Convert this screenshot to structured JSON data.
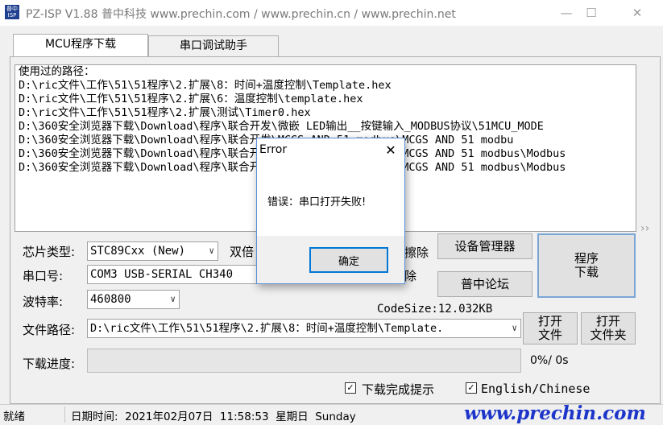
{
  "window": {
    "title": "PZ-ISP V1.88 普中科技 www.prechin.com / www.prechin.cn / www.prechin.net",
    "icon_label": "普中ISP"
  },
  "tabs": [
    {
      "label": "MCU程序下载",
      "active": true
    },
    {
      "label": "串口调试助手",
      "active": false
    }
  ],
  "path_list": {
    "lines": [
      "使用过的路径：",
      "D:\\ric文件\\工作\\51\\51程序\\2.扩展\\8：时间+温度控制\\Template.hex",
      "D:\\ric文件\\工作\\51\\51程序\\2.扩展\\6：温度控制\\template.hex",
      "D:\\ric文件\\工作\\51\\51程序\\2.扩展\\测试\\Timer0.hex",
      "D:\\360安全浏览器下载\\Download\\程序\\联合开发\\微嵌 LED输出__按键输入_MODBUS协议\\51MCU_MODE",
      "D:\\360安全浏览器下载\\Download\\程序\\联合开发\\MCGS-AND-51-modbus\\MCGS AND 51 modbu",
      "D:\\360安全浏览器下载\\Download\\程序\\联合开发\\MCGS-AND-51-modbus\\MCGS AND 51 modbus\\Modbus",
      "D:\\360安全浏览器下载\\Download\\程序\\联合开发\\MCGS-AND-51-modbus\\MCGS AND 51 modbus\\Modbus"
    ]
  },
  "form": {
    "chip_label": "芯片类型:",
    "chip_value": "STC89Cxx (New)",
    "double_speed_label": "双倍",
    "erase_label": "擦除",
    "erase_label2": "除",
    "port_label": "串口号:",
    "port_value": "COM3  USB-SERIAL CH340",
    "baud_label": "波特率:",
    "baud_value": "460800",
    "code_size": "CodeSize:12.032KB",
    "file_path_label": "文件路径:",
    "file_path_value": "D:\\ric文件\\工作\\51\\51程序\\2.扩展\\8：时间+温度控制\\Template.",
    "progress_label": "下载进度:",
    "progress_text": "0%/ 0s",
    "progress_value": 0
  },
  "buttons": {
    "device_manager": "设备管理器",
    "forum": "普中论坛",
    "download": "程序\n下载",
    "open_file": "打开\n文件",
    "open_folder": "打开\n文件夹"
  },
  "checkboxes": {
    "download_done_tip": {
      "label": "下载完成提示",
      "checked": true
    },
    "language": {
      "label": "English/Chinese",
      "checked": true
    }
  },
  "status_bar": {
    "state": "就绪",
    "datetime": "日期时间:  2021年02月07日  11:58:53  星期日  Sunday",
    "brand": "www.prechin.com"
  },
  "dialog": {
    "title": "Error",
    "message": "错误：串口打开失败!",
    "ok_label": "确定"
  },
  "icons": {
    "close": "close-icon",
    "minimize": "minimize-icon",
    "maximize": "maximize-icon",
    "dropdown": "chevron-down-icon"
  }
}
